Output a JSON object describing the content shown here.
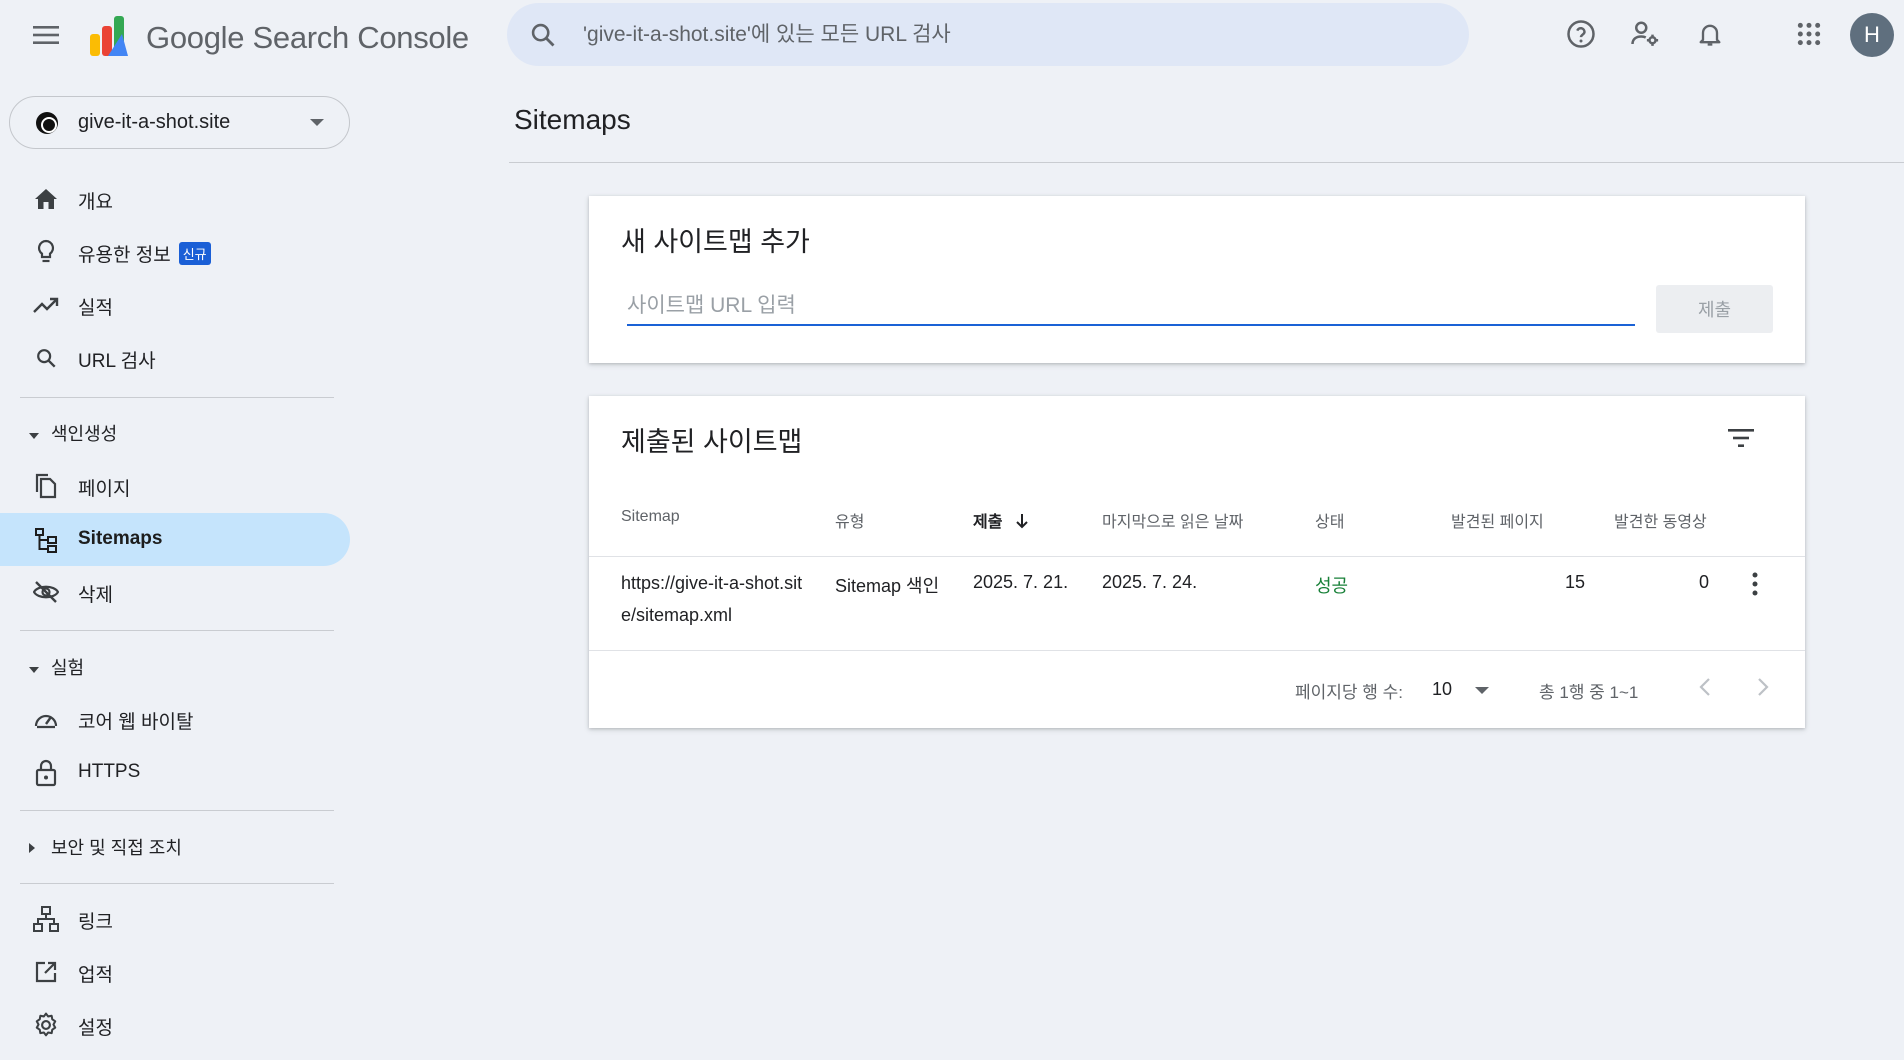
{
  "header": {
    "brand_google": "Google",
    "brand_product": "Search Console",
    "search_placeholder": "'give-it-a-shot.site'에 있는 모든 URL 검사",
    "avatar_letter": "H"
  },
  "property": {
    "name": "give-it-a-shot.site"
  },
  "sidebar": {
    "items_top": [
      {
        "label": "개요"
      },
      {
        "label": "유용한 정보",
        "badge": "신규"
      },
      {
        "label": "실적"
      },
      {
        "label": "URL 검사"
      }
    ],
    "section_indexing": "색인생성",
    "items_indexing": [
      {
        "label": "페이지"
      },
      {
        "label": "Sitemaps"
      },
      {
        "label": "삭제"
      }
    ],
    "section_experience": "실험",
    "items_experience": [
      {
        "label": "코어 웹 바이탈"
      },
      {
        "label": "HTTPS"
      }
    ],
    "section_security": "보안 및 직접 조치",
    "items_bottom": [
      {
        "label": "링크"
      },
      {
        "label": "업적"
      },
      {
        "label": "설정"
      }
    ]
  },
  "main": {
    "page_title": "Sitemaps",
    "add_card": {
      "title": "새 사이트맵 추가",
      "input_placeholder": "사이트맵 URL 입력",
      "submit_label": "제출"
    },
    "submitted_card": {
      "title": "제출된 사이트맵",
      "columns": [
        "Sitemap",
        "유형",
        "제출",
        "마지막으로 읽은 날짜",
        "상태",
        "발견된 페이지",
        "발견한 동영상"
      ],
      "rows": [
        {
          "sitemap": "https://give-it-a-shot.site/sitemap.xml",
          "type": "Sitemap 색인",
          "submitted": "2025. 7. 21.",
          "last_read": "2025. 7. 24.",
          "status": "성공",
          "pages": "15",
          "videos": "0"
        }
      ],
      "pager": {
        "rows_per_page_label": "페이지당 행 수:",
        "rows_per_page": "10",
        "range": "총 1행 중 1~1"
      }
    }
  },
  "colors": {
    "accent": "#1a62d6",
    "active_nav": "#c5e4fc",
    "success": "#188038",
    "background": "#eef1f6"
  }
}
